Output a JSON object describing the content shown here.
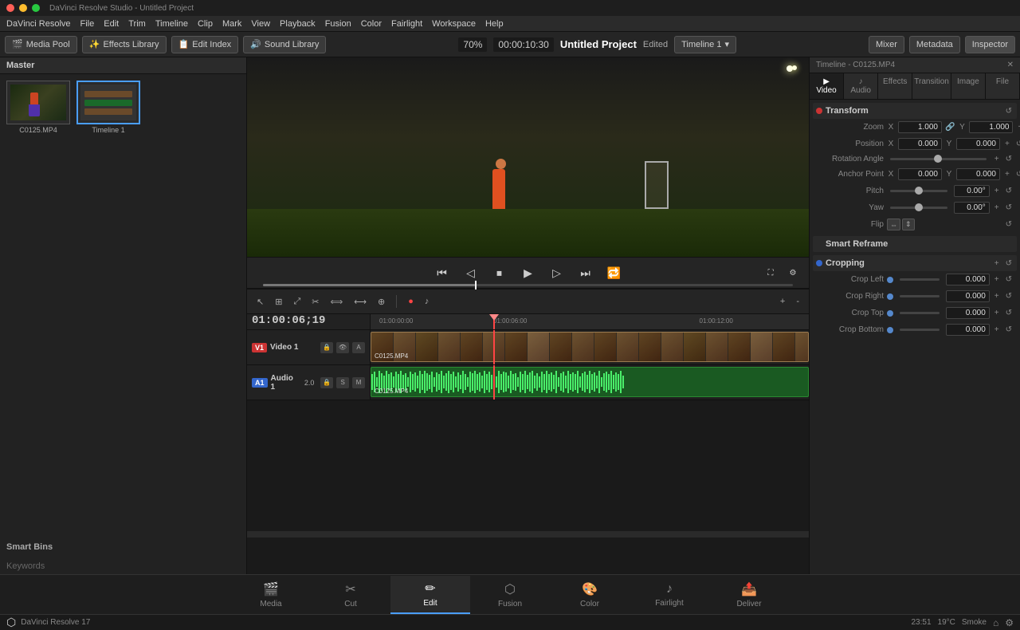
{
  "window": {
    "title": "DaVinci Resolve Studio - Untitled Project",
    "app_name": "DaVinci Resolve Studio - Untitled Project"
  },
  "menu": {
    "items": [
      "DaVinci Resolve",
      "File",
      "Edit",
      "Trim",
      "Timeline",
      "Clip",
      "Mark",
      "View",
      "Playback",
      "Fusion",
      "Color",
      "Fairlight",
      "Workspace",
      "Help"
    ]
  },
  "toolbar": {
    "media_pool": "Media Pool",
    "effects_library": "Effects Library",
    "edit_index": "Edit Index",
    "sound_library": "Sound Library",
    "zoom": "70%",
    "timecode": "00:00:10:30",
    "project_title": "Untitled Project",
    "edited_badge": "Edited",
    "timeline_name": "Timeline 1",
    "mixer": "Mixer",
    "metadata": "Metadata",
    "inspector": "Inspector",
    "inspector_timeline": "Timeline - C0125.MP4"
  },
  "media_pool": {
    "title": "Master",
    "items": [
      {
        "name": "C0125.MP4",
        "type": "video"
      },
      {
        "name": "Timeline 1",
        "type": "timeline"
      }
    ],
    "smart_bins": "Smart Bins",
    "keywords": "Keywords"
  },
  "preview": {
    "timecode": "01:00:06:19"
  },
  "playback": {
    "buttons": [
      "⏮",
      "◁",
      "⏹",
      "▷",
      "▶",
      "⏭",
      "🔁"
    ]
  },
  "timeline": {
    "timecode": "01:00:06;19",
    "name": "Timeline 1",
    "ruler_marks": [
      "01:00:00:00",
      "01:00:06:00",
      "01:00:12:00"
    ],
    "tracks": [
      {
        "id": "V1",
        "name": "Video 1",
        "type": "video",
        "clip_name": "C0125.MP4"
      },
      {
        "id": "A1",
        "name": "Audio 1",
        "type": "audio",
        "level": "2.0",
        "clip_name": "C0125.MP4"
      }
    ]
  },
  "inspector": {
    "title": "Timeline - C0125.MP4",
    "tabs": [
      "Video",
      "Audio",
      "Effects",
      "Transition",
      "Image",
      "File"
    ],
    "sections": {
      "transform": {
        "title": "Transform",
        "fields": {
          "zoom_x": "1.000",
          "zoom_y": "1.000",
          "position_x": "0.000",
          "position_y": "0.000",
          "rotation_angle": "",
          "anchor_x": "0.000",
          "anchor_y": "0.000",
          "pitch": "0.00°",
          "yaw": "0.00°",
          "flip": ""
        }
      },
      "smart_reframe": {
        "title": "Smart Reframe"
      },
      "cropping": {
        "title": "Cropping",
        "fields": {
          "crop_left": "0.000",
          "crop_right": "0.000",
          "crop_top": "0.000",
          "crop_bottom": "0.000"
        }
      }
    }
  },
  "bottom_nav": {
    "items": [
      {
        "id": "media",
        "label": "Media",
        "icon": "🎬"
      },
      {
        "id": "cut",
        "label": "Cut",
        "icon": "✂️"
      },
      {
        "id": "edit",
        "label": "Edit",
        "icon": "📝",
        "active": true
      },
      {
        "id": "fusion",
        "label": "Fusion",
        "icon": "🔷"
      },
      {
        "id": "color",
        "label": "Color",
        "icon": "🎨"
      },
      {
        "id": "fairlight",
        "label": "Fairlight",
        "icon": "🎵"
      },
      {
        "id": "deliver",
        "label": "Deliver",
        "icon": "📤"
      }
    ]
  },
  "taskbar": {
    "time": "23:51",
    "temp": "19°C",
    "location": "Smoke"
  }
}
